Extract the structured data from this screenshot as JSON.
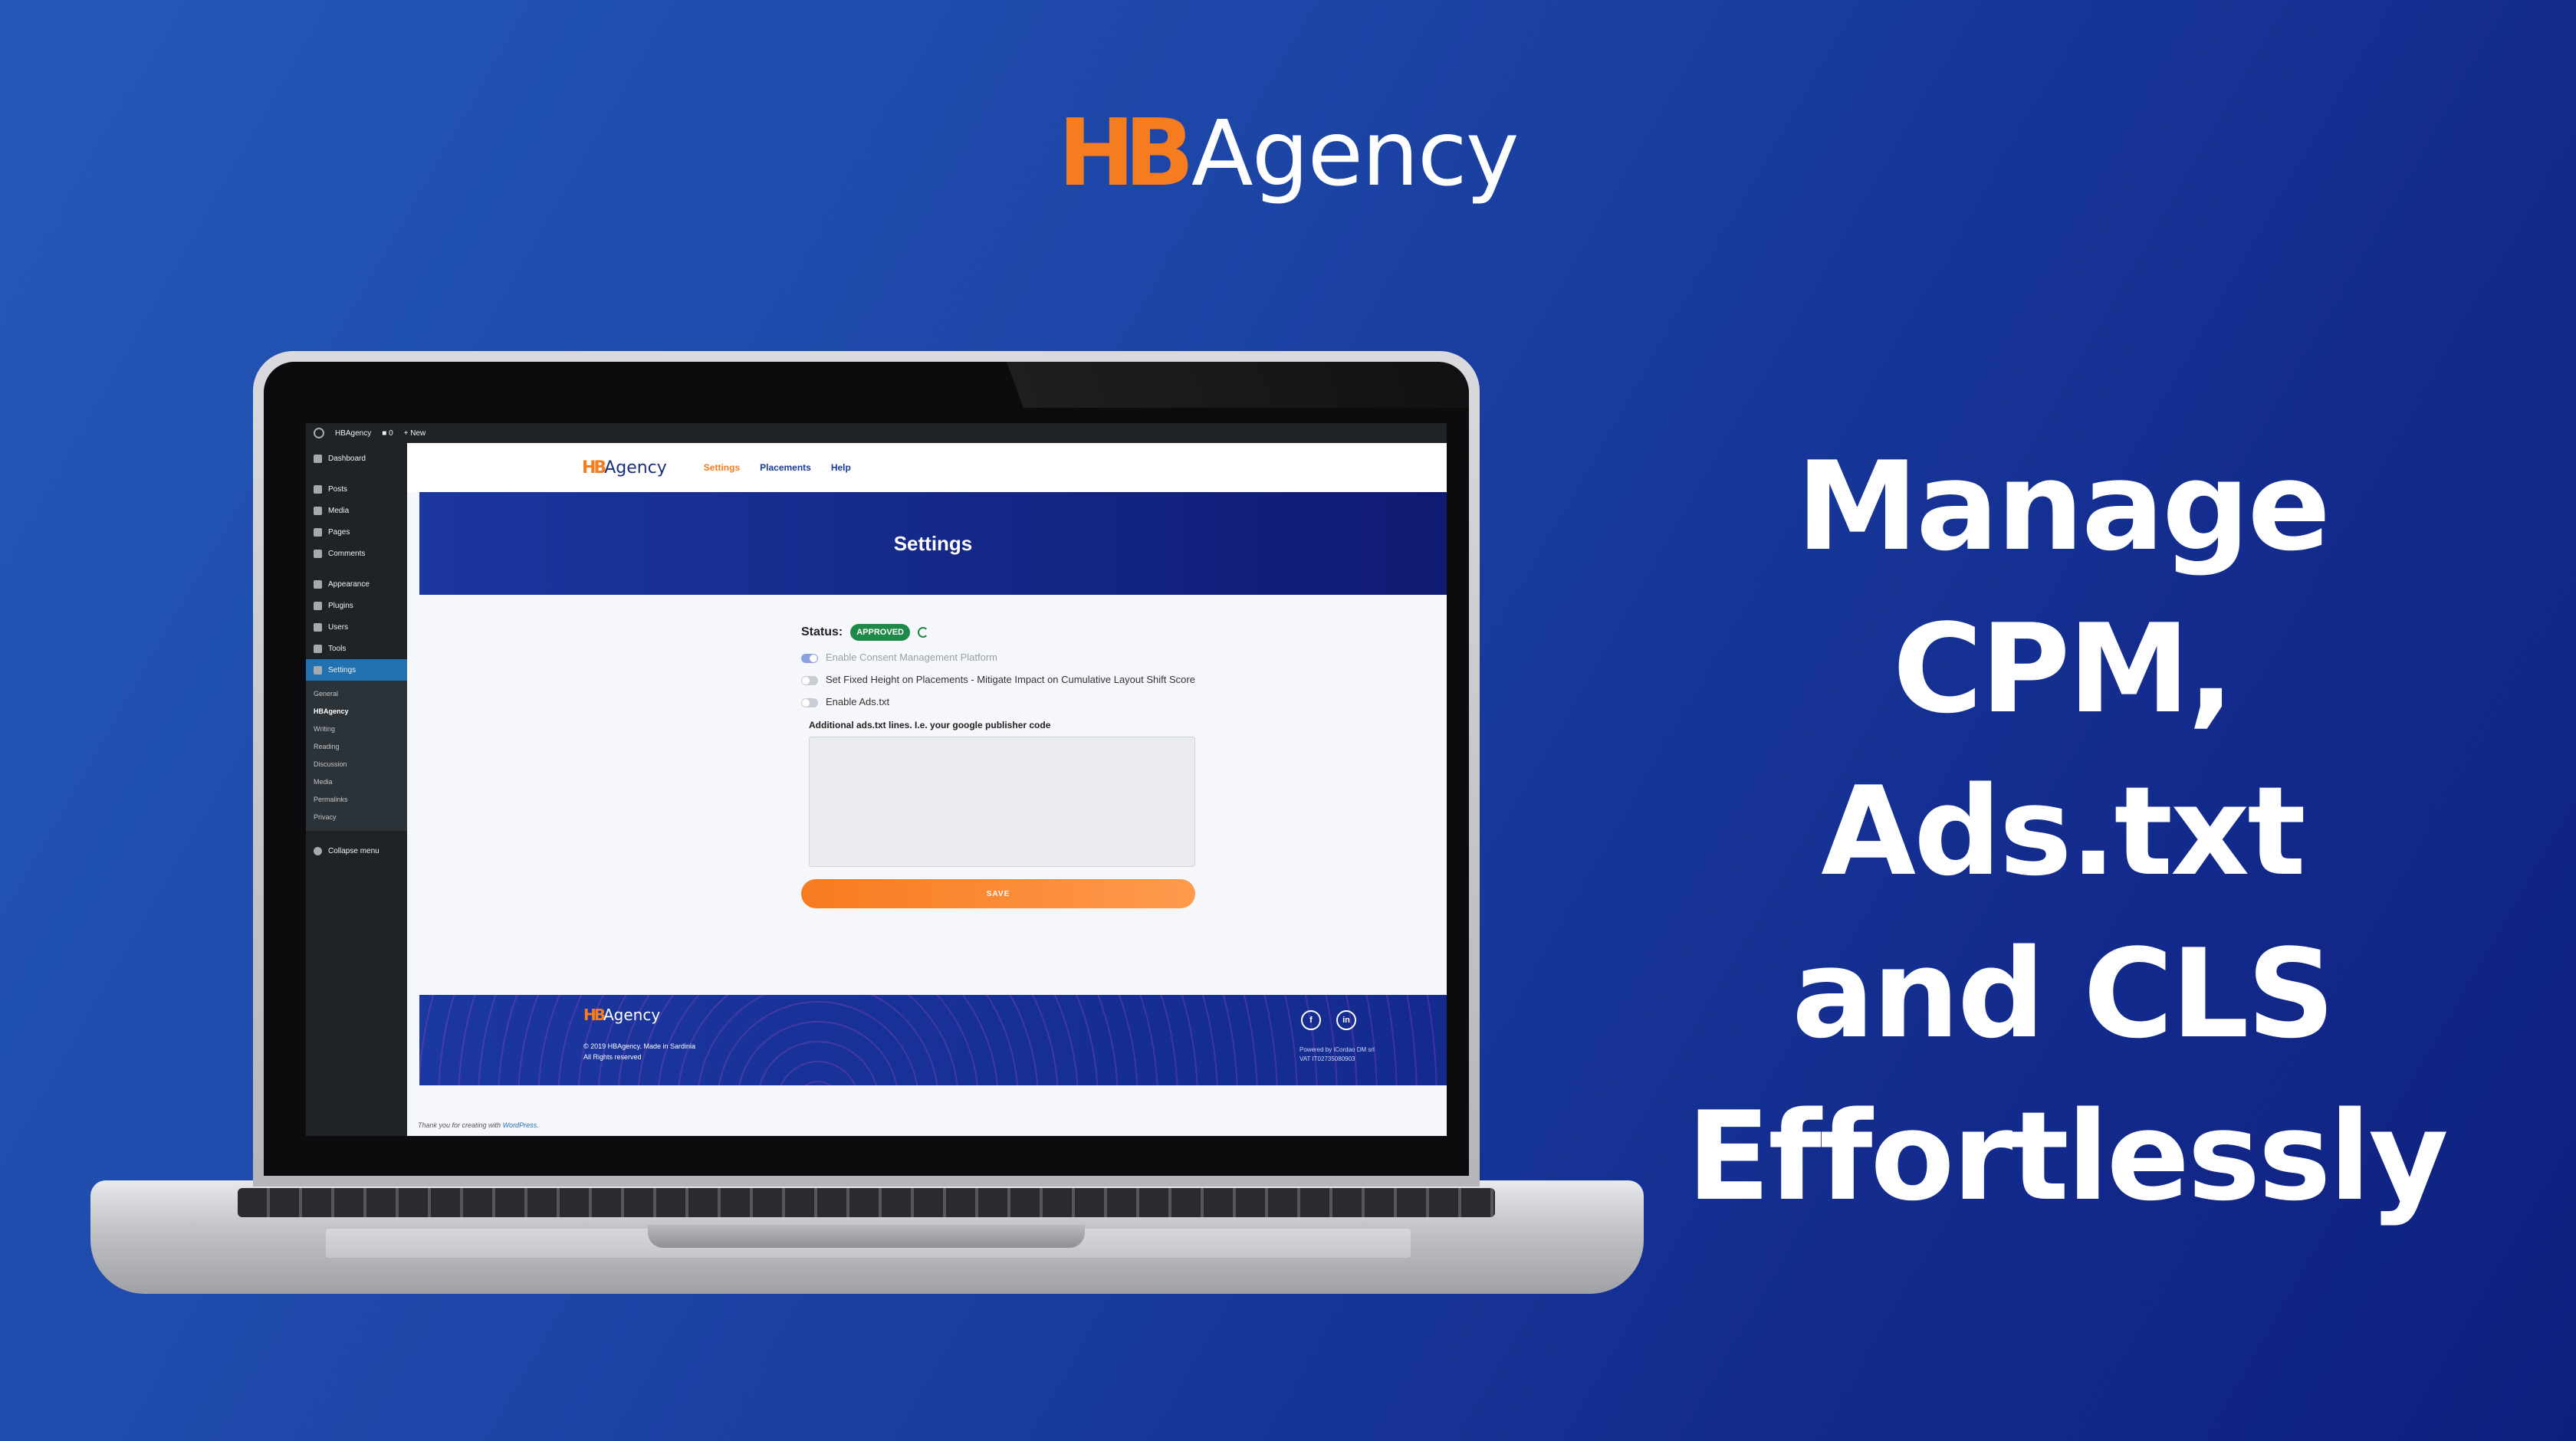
{
  "brand": {
    "logo_mark": "HB",
    "logo_word": "Agency"
  },
  "headline": [
    "Manage",
    "CPM,",
    "Ads.txt",
    "and CLS",
    "Effortlessly"
  ],
  "adminbar": {
    "site": "HBAgency",
    "comments": "0",
    "new": "New"
  },
  "sidebar": {
    "items": [
      "Dashboard",
      "Posts",
      "Media",
      "Pages",
      "Comments",
      "Appearance",
      "Plugins",
      "Users",
      "Tools",
      "Settings"
    ],
    "submenu": [
      "General",
      "HBAgency",
      "Writing",
      "Reading",
      "Discussion",
      "Media",
      "Permalinks",
      "Privacy"
    ],
    "collapse": "Collapse menu"
  },
  "plugin": {
    "logo_mark": "HB",
    "logo_word": "Agency",
    "nav": [
      "Settings",
      "Placements",
      "Help"
    ],
    "hero_title": "Settings",
    "status_label": "Status:",
    "status_value": "APPROVED",
    "options": [
      {
        "label": "Enable Consent Management Platform",
        "on": true,
        "disabled": true
      },
      {
        "label": "Set Fixed Height on Placements - Mitigate Impact on Cumulative Layout Shift Score",
        "on": false,
        "disabled": false
      },
      {
        "label": "Enable Ads.txt",
        "on": false,
        "disabled": false
      }
    ],
    "textarea_label": "Additional ads.txt lines. I.e. your google publisher code",
    "save": "SAVE"
  },
  "footer": {
    "copy1": "© 2019 HBAgency. Made in Sardinia",
    "copy2": "All Rights reserved",
    "powered1": "Powered by iCordao DM srl",
    "powered2": "VAT IT02735080903"
  },
  "thanks": {
    "text": "Thank you for creating with ",
    "link": "WordPress."
  },
  "colors": {
    "accent": "#f57c1f",
    "brand_blue": "#1b37a0",
    "approved": "#1d8a4a"
  }
}
